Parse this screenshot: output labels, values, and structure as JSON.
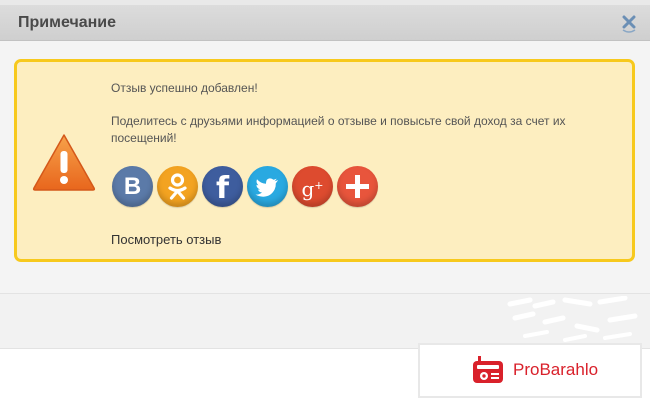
{
  "dialog": {
    "title": "Примечание",
    "close_icon": "close-icon"
  },
  "notice": {
    "icon": "warning-icon",
    "success_message": "Отзыв успешно добавлен!",
    "share_message": "Поделитесь с друзьями информацией о отзыве и повысьте свой доход за счет их посещений!",
    "view_review_label": "Посмотреть отзыв"
  },
  "social": {
    "buttons": [
      {
        "network": "vkontakte",
        "label": "В",
        "color": "#5b7aa8"
      },
      {
        "network": "odnoklassniki",
        "icon": "odnoklassniki-icon",
        "color": "#f3a321"
      },
      {
        "network": "facebook",
        "label": "f",
        "color": "#3e5d9e"
      },
      {
        "network": "twitter",
        "icon": "twitter-bird-icon",
        "color": "#29a9e1"
      },
      {
        "network": "google-plus",
        "label": "g",
        "sup": "+",
        "color": "#dd4b2f"
      },
      {
        "network": "more",
        "icon": "plus-icon",
        "color": "#e8553c"
      }
    ]
  },
  "brand": {
    "name": "ProBarahlo",
    "icon": "radio-icon",
    "color": "#d9212b"
  },
  "colors": {
    "notice_background": "#fdeec0",
    "notice_border": "#f7c91d",
    "header_background": "#d6d6d6"
  }
}
